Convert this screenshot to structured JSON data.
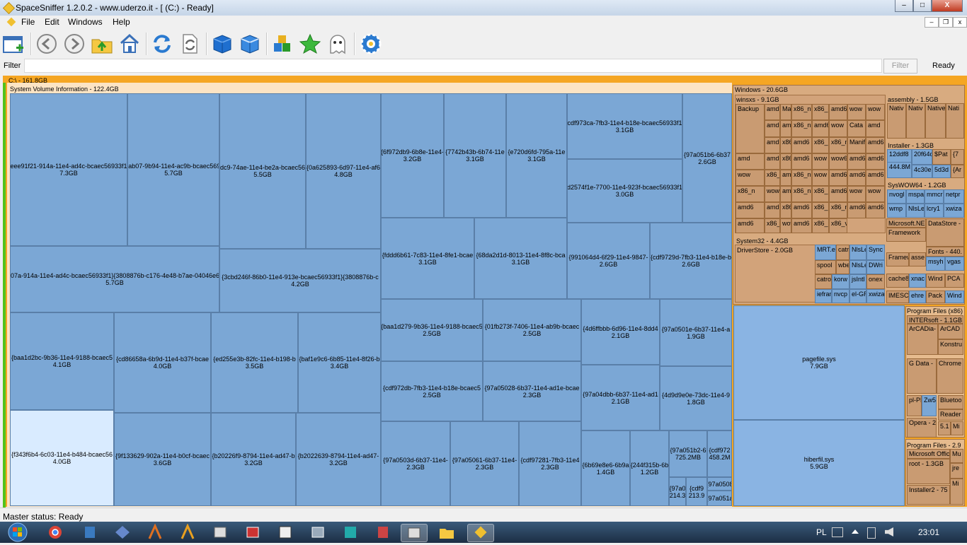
{
  "window": {
    "title": "SpaceSniffer 1.2.0.2 - www.uderzo.it - [ (C:) - Ready]"
  },
  "menu": [
    "File",
    "Edit",
    "Windows",
    "Help"
  ],
  "filter": {
    "label": "Filter",
    "value": "",
    "button": "Filter",
    "status": "Ready"
  },
  "drive": {
    "label": "C:\\ - 161.8GB"
  },
  "svi": {
    "label": "System Volume Information - 122.4GB",
    "tiles": [
      {
        "name": "{eee91f21-914a-11e4-ad4c-bcaec56933f1}",
        "size": "7.3GB"
      },
      {
        "name": "{2b28ab07-9b94-11e4-ac9b-bcaec56933f1}",
        "size": "5.7GB"
      },
      {
        "name": "{2b6f8dc9-74ae-11e4-be2a-bcaec56933f1}",
        "size": "5.5GB"
      },
      {
        "name": "{0a625893-6d97-11e4-af6",
        "size": "4.8GB"
      },
      {
        "name": "{6f972db9-6b8e-11e4-",
        "size": "3.2GB"
      },
      {
        "name": "{7742b43b-6b74-11e",
        "size": "3.1GB"
      },
      {
        "name": "{e720d6fd-795a-11e",
        "size": "3.1GB"
      },
      {
        "name": "{cdf973ca-7fb3-11e4-b18e-bcaec56933f1}",
        "size": "3.1GB"
      },
      {
        "name": "{97a051b6-6b37",
        "size": "2.6GB"
      },
      {
        "name": "{d2574f1e-7700-11e4-923f-bcaec56933f1}",
        "size": "3.0GB"
      },
      {
        "name": "{eee9207a-914a-11e4-ad4c-bcaec56933f1}{3808876b-c176-4e48-b7ae-04046e6cc752}",
        "size": "5.7GB"
      },
      {
        "name": "{3cbd246f-86b0-11e4-913e-bcaec56933f1}{3808876b-c",
        "size": "4.2GB"
      },
      {
        "name": "{fddd6b61-7c83-11e4-8fe1-bcae",
        "size": "3.1GB"
      },
      {
        "name": "{68da2d1d-8013-11e4-8f8c-bca",
        "size": "3.1GB"
      },
      {
        "name": "{991064d4-6f29-11e4-9847-",
        "size": "2.6GB"
      },
      {
        "name": "{cdf9729d-7fb3-11e4-b18e-b",
        "size": "2.6GB"
      },
      {
        "name": "{baa1d2bc-9b36-11e4-9188-bcaec5",
        "size": "4.1GB"
      },
      {
        "name": "{cd86658a-6b9d-11e4-b37f-bcae",
        "size": "4.0GB"
      },
      {
        "name": "{ed255e3b-82fc-11e4-b198-b",
        "size": "3.5GB"
      },
      {
        "name": "{baf1e9c6-6b85-11e4-8f26-b",
        "size": "3.4GB"
      },
      {
        "name": "{baa1d279-9b36-11e4-9188-bcaec5",
        "size": "2.5GB"
      },
      {
        "name": "{01fb273f-7406-11e4-ab9b-bcaec",
        "size": "2.5GB"
      },
      {
        "name": "{4d6ffbbb-6d96-11e4-8dd4",
        "size": "2.1GB"
      },
      {
        "name": "{97a0501e-6b37-11e4-a",
        "size": "1.9GB"
      },
      {
        "name": "{cdf972db-7fb3-11e4-b18e-bcaec5",
        "size": "2.5GB"
      },
      {
        "name": "{97a05028-6b37-11e4-ad1e-bcae",
        "size": "2.3GB"
      },
      {
        "name": "{97a04dbb-6b37-11e4-ad1",
        "size": "2.1GB"
      },
      {
        "name": "{4d9d9e0e-73dc-11e4-9",
        "size": "1.8GB"
      },
      {
        "name": "{f343f6b4-6c03-11e4-b484-bcaec56",
        "size": "4.0GB"
      },
      {
        "name": "{9f133629-902a-11e4-b0cf-bcaec",
        "size": "3.6GB"
      },
      {
        "name": "{b20226f9-8794-11e4-ad47-b",
        "size": "3.2GB"
      },
      {
        "name": "{b2022639-8794-11e4-ad47-",
        "size": "3.2GB"
      },
      {
        "name": "{97a0503d-6b37-11e4-",
        "size": "2.3GB"
      },
      {
        "name": "{97a05061-6b37-11e4-",
        "size": "2.3GB"
      },
      {
        "name": "{cdf97281-7fb3-11e4",
        "size": "2.3GB"
      },
      {
        "name": "{6b69e8e6-6b9a",
        "size": "1.4GB"
      },
      {
        "name": "{244f315b-6b",
        "size": "1.2GB"
      },
      {
        "name": "{97a051b2-6",
        "size": "725.2MB"
      },
      {
        "name": "{cdf972",
        "size": "458.2M"
      },
      {
        "name": "{97a0",
        "size": "214.3"
      },
      {
        "name": "{cdf9",
        "size": "213.9"
      },
      {
        "name": "{97a0508",
        "size": ""
      },
      {
        "name": "{97a051a",
        "size": ""
      }
    ]
  },
  "windows": {
    "label": "Windows - 20.6GB",
    "winsxs": {
      "label": "winsxs - 9.1GB",
      "cells": [
        "Backup",
        "amd",
        "ManifestC",
        "x86_n",
        "x86_s",
        "amd6",
        "wow",
        "wow",
        "amd",
        "amd6",
        "x86_n",
        "amd6",
        "wow",
        "Cata",
        "amd",
        "amd6",
        "x86_n",
        "amd6",
        "x86_n",
        "x86_mi",
        "Manife",
        "amd6",
        "amd",
        "amd6",
        "x86_n",
        "amd6",
        "wow",
        "wow6",
        "amd6",
        "amd6",
        "wow",
        "x86_n",
        "amd6",
        "x86_n",
        "wow",
        "amd6",
        "amd6",
        "amd6",
        "x86_n",
        "wow6",
        "amd6",
        "x86_n",
        "x86_n",
        "amd6",
        "wow",
        "wow",
        "amd6",
        "amd6",
        "x86_n",
        "amd6",
        "x86_n",
        "x86_n",
        "amd6",
        "amd6",
        "amd6",
        "x86_a",
        "wow",
        "amd6",
        "x86_n",
        "x86_v"
      ]
    },
    "assembly": {
      "label": "assembly - 1.5GB",
      "cells": [
        "Nativ",
        "Nativ",
        "Native",
        "Nati"
      ]
    },
    "installer": {
      "label": "Installer - 1.3GB",
      "cells": [
        "12ddf8",
        "444.8M",
        "20f64c",
        "$Pat",
        "{7",
        "4c30e",
        "5d3d",
        "{Ar"
      ]
    },
    "syswow64": {
      "label": "SysWOW64 - 1.2GB",
      "cells": [
        "nvogl",
        "mspa",
        "mmcr",
        "netpr",
        "wmp",
        "NlsLe",
        "lcry1",
        "xwiza"
      ]
    },
    "system32": {
      "label": "System32 - 4.4GB",
      "driverstore": "DriverStore - 2.0GB",
      "cells": [
        "MRT.e",
        "catr",
        "NlsLe",
        "Sync",
        "spool",
        "wbe",
        "NlsLe",
        "DWri",
        "catroo",
        "korw",
        "jsIntl",
        "onex",
        "iefran",
        "nvcp",
        "el-GR",
        "xwiza"
      ]
    },
    "misc": [
      "Microsoft.NE",
      "Framework",
      "Framew",
      "asse",
      "cache8",
      "xnac",
      "IMESC",
      "ehre",
      "DataStore -",
      "Fonts - 440.",
      "msyh",
      "vgas",
      "Wind",
      "PCA",
      "Pack",
      "Wind"
    ]
  },
  "pagefile": {
    "name": "pagefile.sys",
    "size": "7.9GB"
  },
  "hiberfil": {
    "name": "hiberfil.sys",
    "size": "5.9GB"
  },
  "progfiles86": {
    "label": "Program Files (x86)",
    "cells": [
      "INTERsoft - 1.1GB",
      "ArCADia-",
      "ArCAD",
      "Konstru",
      "G Data -",
      "Chrome",
      "pl-PL",
      "Zw5 4KB",
      "Bluetoo",
      "Reader",
      "Opera - 2",
      "5.1",
      "Mi"
    ]
  },
  "progfiles": {
    "label": "Program Files - 2.9",
    "cells": [
      "Microsoft Offic",
      "root - 1.3GB",
      "Mu",
      "jre",
      "Installer2 - 75",
      "Mi"
    ]
  },
  "status": {
    "master": "Master status: Ready"
  },
  "taskbar": {
    "lang": "PL",
    "time": "23:01"
  }
}
